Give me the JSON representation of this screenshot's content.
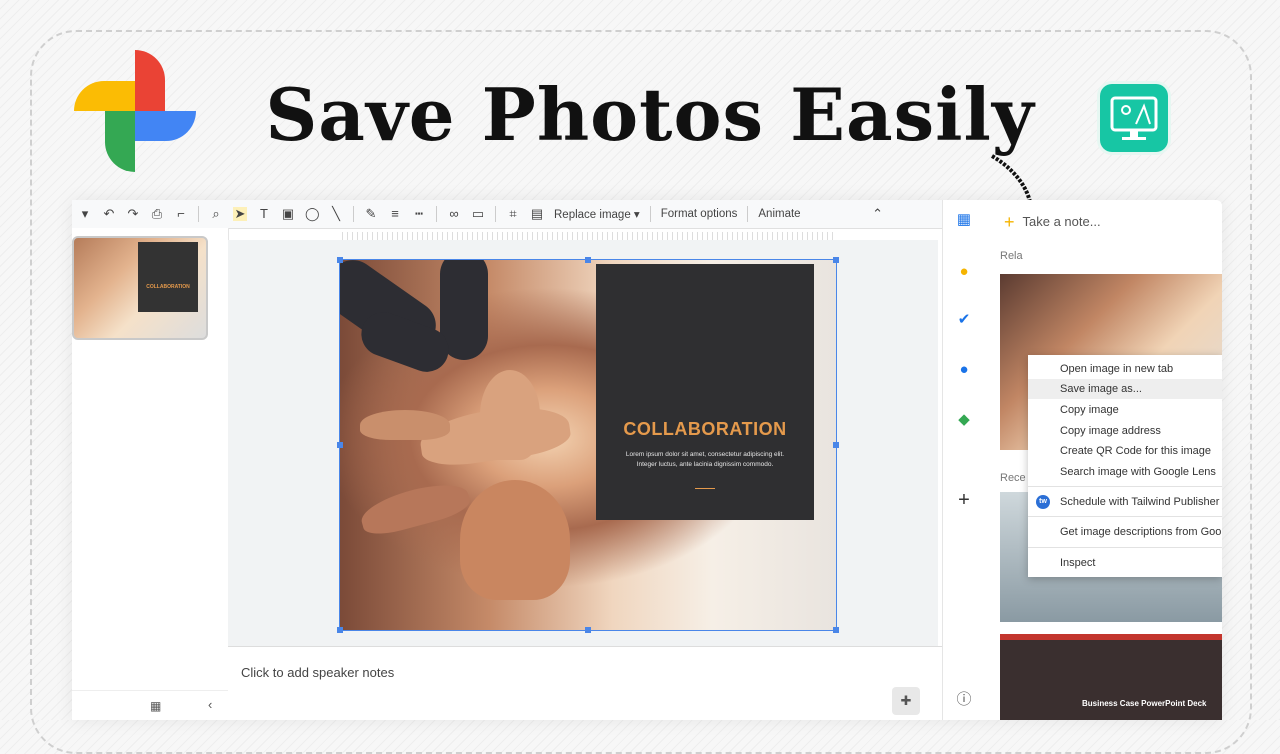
{
  "headline": "Save Photos Easily",
  "toolbar": {
    "replace_image": "Replace image",
    "format_options": "Format options",
    "animate": "Animate"
  },
  "slide": {
    "title": "COLLABORATION",
    "body": "Lorem ipsum dolor sit amet, consectetur adipiscing elit. Integer luctus, ante lacinia dignissim commodo.",
    "thumb_title": "COLLABORATION"
  },
  "notes": {
    "placeholder": "Click to add speaker notes"
  },
  "keep": {
    "take_note": "Take a note...",
    "label_related": "Rela",
    "label_recent": "Rece",
    "deck_title": "Business Case PowerPoint Deck"
  },
  "context_menu": {
    "items": [
      "Open image in new tab",
      "Save image as...",
      "Copy image",
      "Copy image address",
      "Create QR Code for this image",
      "Search image with Google Lens",
      "Schedule with Tailwind Publisher",
      "Get image descriptions from Goo",
      "Inspect"
    ],
    "highlighted": "Save image as..."
  },
  "colors": {
    "accent_orange": "#e59a4c",
    "selection_blue": "#4a86e8",
    "badge_green": "#17c6a4"
  }
}
